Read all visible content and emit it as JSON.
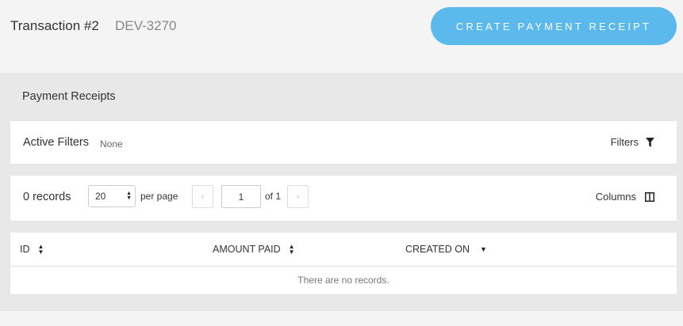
{
  "header": {
    "title": "Transaction #2",
    "subtitle": "DEV-3270",
    "create_button": "CREATE PAYMENT RECEIPT"
  },
  "section": {
    "title": "Payment Receipts"
  },
  "filters": {
    "active_label": "Active Filters",
    "active_value": "None",
    "button_label": "Filters"
  },
  "paging": {
    "records": "0 records",
    "per_page_value": "20",
    "per_page_label": "per page",
    "prev": "‹",
    "next": "›",
    "page": "1",
    "of": "of 1",
    "columns_label": "Columns"
  },
  "table": {
    "columns": [
      "ID",
      "AMOUNT PAID",
      "CREATED ON"
    ],
    "empty_message": "There are no records."
  },
  "colors": {
    "accent": "#5bb9ec"
  }
}
